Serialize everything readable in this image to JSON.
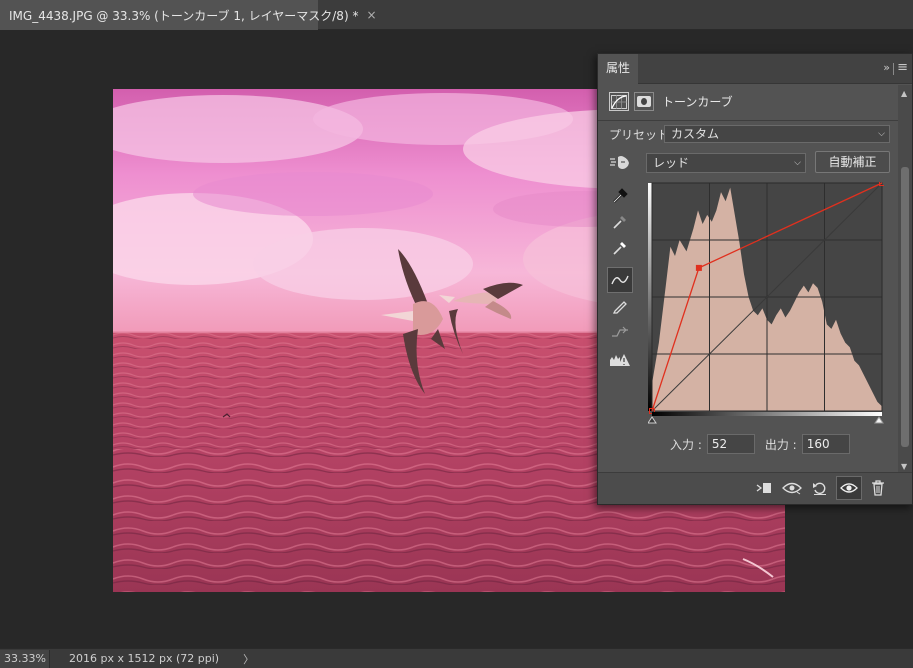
{
  "document_tab": {
    "title": "IMG_4438.JPG @ 33.3% (トーンカーブ 1, レイヤーマスク/8) *",
    "close_glyph": "×"
  },
  "status_bar": {
    "zoom": "33.33%",
    "document_size": "2016 px x 1512 px (72 ppi)",
    "arrow": "〉"
  },
  "properties_panel": {
    "tab_label": "属性",
    "collapse_glyph": "»",
    "menu_glyph": "≡",
    "adjustment_title": "トーンカーブ",
    "preset_label": "プリセット :",
    "preset_value": "カスタム",
    "channel_value": "レッド",
    "auto_button": "自動補正",
    "input_label": "入力 :",
    "input_value": "52",
    "output_label": "出力 :",
    "output_value": "160",
    "tools": [
      "sample-black-point-eyedropper-icon",
      "sample-gray-point-eyedropper-icon",
      "sample-white-point-eyedropper-icon",
      "edit-points-curve-icon",
      "draw-curve-pencil-icon",
      "smooth-curve-icon",
      "clipping-warning-icon"
    ],
    "footer_icons": [
      "clip-to-layer-icon",
      "view-previous-state-icon",
      "reset-adjustment-icon",
      "toggle-visibility-icon",
      "delete-adjustment-icon"
    ],
    "curve": {
      "channel": "red",
      "points": [
        [
          0,
          0
        ],
        [
          52,
          160
        ],
        [
          255,
          255
        ]
      ],
      "curve_color": "#e0301e",
      "histogram_color": "#d4b2a4"
    }
  },
  "colors": {
    "app_background": "#282828",
    "panel_background": "#535353",
    "photo_tint": "#e8708a"
  }
}
